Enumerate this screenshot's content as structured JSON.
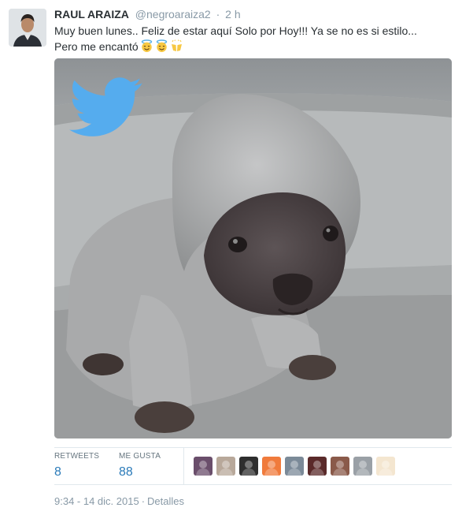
{
  "tweet": {
    "author_name": "RAUL ARAIZA",
    "author_handle": "@negroaraiza2",
    "separator": "·",
    "time_ago": "2 h",
    "text": "Muy buen lunes.. Feliz de estar  aquí Solo por Hoy!!! Ya se no es si estilo...\nPero me encantó",
    "emojis": [
      "smiling-face-with-halo",
      "smiling-face-with-halo",
      "raised-hands"
    ]
  },
  "media": {
    "overlay_icon": "twitter-bird-icon",
    "accent": "#55acee"
  },
  "stats": {
    "retweets_label": "RETWEETS",
    "retweets_value": "8",
    "likes_label": "ME GUSTA",
    "likes_value": "88",
    "value_color": "#2b7bb9"
  },
  "favoriters": [
    {
      "icon": "avatar-1",
      "color": "#6a4e6b"
    },
    {
      "icon": "avatar-2",
      "color": "#b8a89a"
    },
    {
      "icon": "avatar-3",
      "color": "#2e2e2e"
    },
    {
      "icon": "avatar-4",
      "color": "#f07b3c"
    },
    {
      "icon": "avatar-5",
      "color": "#7b8a98"
    },
    {
      "icon": "avatar-6",
      "color": "#5a2a2a"
    },
    {
      "icon": "avatar-7",
      "color": "#8a5a4a"
    },
    {
      "icon": "avatar-8",
      "color": "#9aa0a6"
    },
    {
      "icon": "avatar-9",
      "color": "#f4e6d0"
    }
  ],
  "footer": {
    "time": "9:34 - 14 dic. 2015",
    "separator": "·",
    "details": "Detalles"
  }
}
